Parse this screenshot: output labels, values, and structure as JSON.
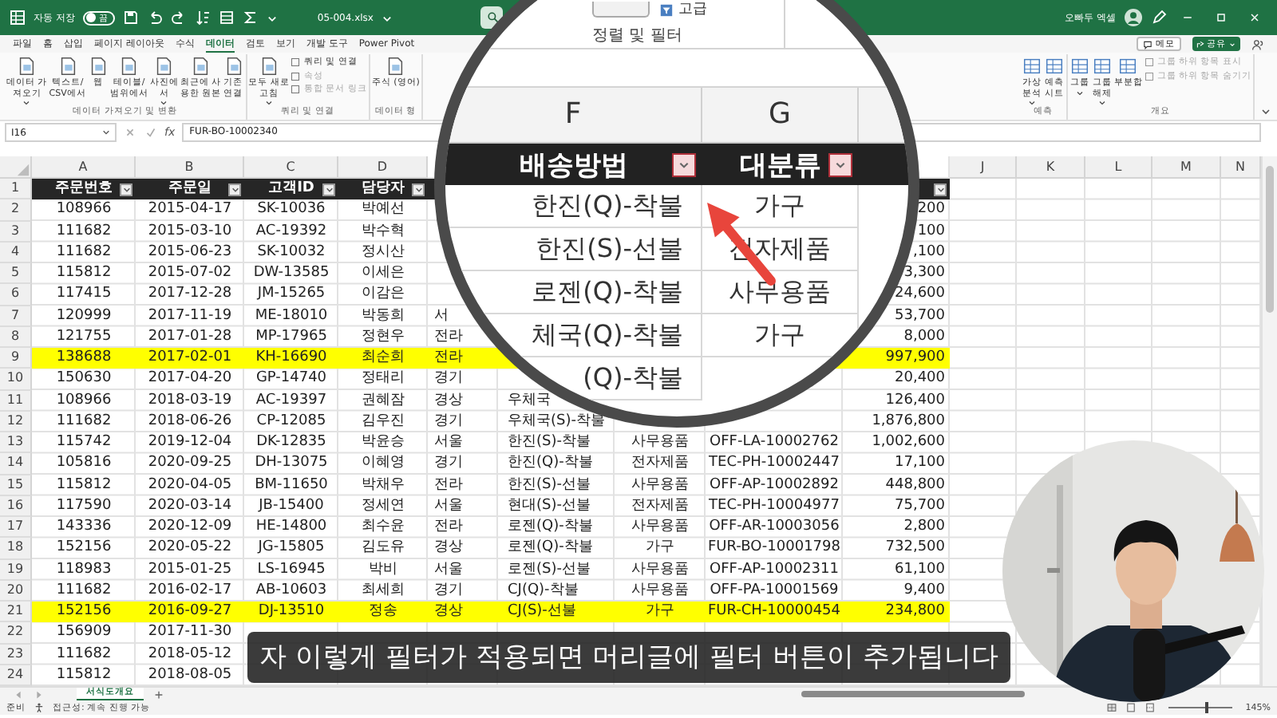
{
  "title_bar": {
    "autosave": {
      "label": "자동 저장",
      "on": false,
      "state": "끔"
    },
    "file_name": "05-004.xlsx",
    "account": "오빠두 엑셀"
  },
  "ribbon_tabs": [
    {
      "label": "파일",
      "selected": false
    },
    {
      "label": "홈",
      "selected": false
    },
    {
      "label": "삽입",
      "selected": false
    },
    {
      "label": "페이지 레이아웃",
      "selected": false
    },
    {
      "label": "수식",
      "selected": false
    },
    {
      "label": "데이터",
      "selected": true
    },
    {
      "label": "검토",
      "selected": false
    },
    {
      "label": "보기",
      "selected": false
    },
    {
      "label": "개발 도구",
      "selected": false
    },
    {
      "label": "Power Pivot",
      "selected": false
    }
  ],
  "comment_button": "메모",
  "share_button": "공유",
  "ribbon_groups": [
    {
      "name": "데이터 가져오기 및 변환",
      "buttons": [
        {
          "lines": [
            "데이터 가",
            "져오기"
          ],
          "dropdown": true
        },
        {
          "lines": [
            "텍스트/",
            "CSV에서"
          ],
          "dropdown": false
        },
        {
          "lines": [
            "웹"
          ],
          "dropdown": false
        },
        {
          "lines": [
            "테이블/",
            "범위에서"
          ],
          "dropdown": false
        },
        {
          "lines": [
            "사진에",
            "서"
          ],
          "dropdown": true
        },
        {
          "lines": [
            "최근에 사",
            "용한 원본"
          ],
          "dropdown": false
        },
        {
          "lines": [
            "기존",
            "연결"
          ],
          "dropdown": false
        }
      ]
    },
    {
      "name": "쿼리 및 연결",
      "buttons": [
        {
          "lines": [
            "모두 새로",
            "고침"
          ],
          "dropdown": true
        }
      ],
      "small_buttons": [
        {
          "label": "쿼리 및 연결",
          "disabled": false
        },
        {
          "label": "속성",
          "disabled": true
        },
        {
          "label": "통합 문서 링크",
          "disabled": true
        }
      ]
    },
    {
      "name": "데이터 형",
      "buttons": [
        {
          "lines": [
            "주식 (영어)"
          ],
          "dropdown": false
        }
      ]
    }
  ],
  "ribbon_groups_right": [
    {
      "name": "예측",
      "buttons": [
        {
          "lines": [
            "가상",
            "분석"
          ],
          "dropdown": true
        },
        {
          "lines": [
            "예측",
            "시트"
          ],
          "dropdown": false
        }
      ]
    },
    {
      "name": "개요",
      "buttons": [
        {
          "lines": [
            "그룹"
          ],
          "dropdown": true
        },
        {
          "lines": [
            "그룹",
            "해제"
          ],
          "dropdown": true
        },
        {
          "lines": [
            "부분합"
          ],
          "dropdown": false
        }
      ],
      "small_buttons": [
        {
          "label": "그룹 하위 항목 표시",
          "disabled": true
        },
        {
          "label": "그룹 하위 항목 숨기기",
          "disabled": true
        }
      ]
    }
  ],
  "formula_bar": {
    "name_box": "I16",
    "function_label": "fx",
    "formula": "FUR-BO-10002340"
  },
  "column_headers": [
    "A",
    "B",
    "C",
    "D",
    "J",
    "K",
    "L",
    "M",
    "N"
  ],
  "header_row": {
    "number": "1",
    "cells": {
      "A": {
        "text": "주문번호",
        "filter": true
      },
      "B": {
        "text": "주문일",
        "filter": true
      },
      "C": {
        "text": "고객ID",
        "filter": true
      },
      "D": {
        "text": "담당자",
        "filter": true
      },
      "I": {
        "filter": true
      }
    }
  },
  "rows": [
    {
      "number": "2",
      "highlighted": false,
      "cells": {
        "A": "108966",
        "B": "2015-04-17",
        "C": "SK-10036",
        "D": "박예선",
        "I": "200"
      }
    },
    {
      "number": "3",
      "highlighted": false,
      "cells": {
        "A": "111682",
        "B": "2015-03-10",
        "C": "AC-19392",
        "D": "박수혁",
        "I": "100"
      }
    },
    {
      "number": "4",
      "highlighted": false,
      "cells": {
        "A": "111682",
        "B": "2015-06-23",
        "C": "SK-10032",
        "D": "정시산",
        "I": ",100"
      }
    },
    {
      "number": "5",
      "highlighted": false,
      "cells": {
        "A": "115812",
        "B": "2015-07-02",
        "C": "DW-13585",
        "D": "이세은",
        "I": "3,300"
      }
    },
    {
      "number": "6",
      "highlighted": false,
      "cells": {
        "A": "117415",
        "B": "2017-12-28",
        "C": "JM-15265",
        "D": "이감은",
        "I": "24,600"
      }
    },
    {
      "number": "7",
      "highlighted": false,
      "cells": {
        "A": "120999",
        "B": "2017-11-19",
        "C": "ME-18010",
        "D": "박동희",
        "E": "서",
        "I": "53,700"
      }
    },
    {
      "number": "8",
      "highlighted": false,
      "cells": {
        "A": "121755",
        "B": "2017-01-28",
        "C": "MP-17965",
        "D": "정현우",
        "E": "전라",
        "I": "8,000"
      }
    },
    {
      "number": "9",
      "highlighted": true,
      "cells": {
        "A": "138688",
        "B": "2017-02-01",
        "C": "KH-16690",
        "D": "최순희",
        "E": "전라",
        "I": "997,900"
      }
    },
    {
      "number": "10",
      "highlighted": false,
      "cells": {
        "A": "150630",
        "B": "2017-04-20",
        "C": "GP-14740",
        "D": "정태리",
        "E": "경기",
        "I": "20,400"
      }
    },
    {
      "number": "11",
      "highlighted": false,
      "cells": {
        "A": "108966",
        "B": "2018-03-19",
        "C": "AC-19397",
        "D": "권혜잠",
        "E": "경상",
        "F": "우체국",
        "I": "126,400"
      }
    },
    {
      "number": "12",
      "highlighted": false,
      "cells": {
        "A": "111682",
        "B": "2018-06-26",
        "C": "CP-12085",
        "D": "김우진",
        "E": "경기",
        "F": "우체국(S)-착불",
        "I": "1,876,800"
      }
    },
    {
      "number": "13",
      "highlighted": false,
      "cells": {
        "A": "115742",
        "B": "2019-12-04",
        "C": "DK-12835",
        "D": "박윤승",
        "E": "서울",
        "F": "한진(S)-착불",
        "G": "사무용품",
        "H": "OFF-LA-10002762",
        "I": "1,002,600"
      }
    },
    {
      "number": "14",
      "highlighted": false,
      "cells": {
        "A": "105816",
        "B": "2020-09-25",
        "C": "DH-13075",
        "D": "이혜영",
        "E": "경기",
        "F": "한진(Q)-착불",
        "G": "전자제품",
        "H": "TEC-PH-10002447",
        "I": "17,100"
      }
    },
    {
      "number": "15",
      "highlighted": false,
      "cells": {
        "A": "115812",
        "B": "2020-04-05",
        "C": "BM-11650",
        "D": "박채우",
        "E": "전라",
        "F": "한진(S)-선불",
        "G": "사무용품",
        "H": "OFF-AP-10002892",
        "I": "448,800"
      }
    },
    {
      "number": "16",
      "highlighted": false,
      "cells": {
        "A": "117590",
        "B": "2020-03-14",
        "C": "JB-15400",
        "D": "정세연",
        "E": "서울",
        "F": "현대(S)-선불",
        "G": "전자제품",
        "H": "TEC-PH-10004977",
        "I": "75,700"
      }
    },
    {
      "number": "17",
      "highlighted": false,
      "cells": {
        "A": "143336",
        "B": "2020-12-09",
        "C": "HE-14800",
        "D": "최수윤",
        "E": "전라",
        "F": "로젠(Q)-착불",
        "G": "사무용품",
        "H": "OFF-AR-10003056",
        "I": "2,800"
      }
    },
    {
      "number": "18",
      "highlighted": false,
      "cells": {
        "A": "152156",
        "B": "2020-05-22",
        "C": "JG-15805",
        "D": "김도유",
        "E": "경상",
        "F": "로젠(Q)-착불",
        "G": "가구",
        "H": "FUR-BO-10001798",
        "I": "732,500"
      }
    },
    {
      "number": "19",
      "highlighted": false,
      "cells": {
        "A": "118983",
        "B": "2015-01-25",
        "C": "LS-16945",
        "D": "박비",
        "E": "서울",
        "F": "로젠(S)-선불",
        "G": "사무용품",
        "H": "OFF-AP-10002311",
        "I": "61,100"
      }
    },
    {
      "number": "20",
      "highlighted": false,
      "cells": {
        "A": "111682",
        "B": "2016-02-17",
        "C": "AB-10603",
        "D": "최세희",
        "E": "경기",
        "F": "CJ(Q)-착불",
        "G": "사무용품",
        "H": "OFF-PA-10001569",
        "I": "9,400"
      }
    },
    {
      "number": "21",
      "highlighted": true,
      "cells": {
        "A": "152156",
        "B": "2016-09-27",
        "C": "DJ-13510",
        "D": "정송",
        "E": "경상",
        "F": "CJ(S)-선불",
        "G": "가구",
        "H": "FUR-CH-10000454",
        "I": "234,800"
      }
    },
    {
      "number": "22",
      "highlighted": false,
      "cells": {
        "A": "156909",
        "B": "2017-11-30"
      }
    },
    {
      "number": "23",
      "highlighted": false,
      "cells": {
        "A": "111682",
        "B": "2018-05-12"
      }
    },
    {
      "number": "24",
      "highlighted": false,
      "cells": {
        "A": "115812",
        "B": "2018-08-05"
      }
    }
  ],
  "magnifier": {
    "ribbon": {
      "button_label": "고급",
      "group_label": "정렬 및 필터"
    },
    "column_headers": [
      "F",
      "G"
    ],
    "header_cells": [
      {
        "text": "배송방법",
        "filter": true
      },
      {
        "text": "대분류",
        "filter": true
      }
    ],
    "rows": [
      {
        "F": "한진(Q)-착불",
        "G": "가구"
      },
      {
        "F": "한진(S)-선불",
        "G": "전자제품"
      },
      {
        "F": "로젠(Q)-착불",
        "G": "사무용품"
      },
      {
        "F": "체국(Q)-착불",
        "G": "가구"
      },
      {
        "F": "(Q)-착불"
      }
    ]
  },
  "subtitle": "자 이렇게 필터가 적용되면 머리글에 필터 버튼이 추가됩니다",
  "presenter_video": {
    "kind": "picture"
  },
  "sheet_tabs": [
    {
      "label": "서식도개요",
      "selected": true
    }
  ],
  "status_bar": {
    "mode": "준비",
    "accessibility": "접근성: 계속 진행 가능",
    "zoom": {
      "level": 0.6,
      "reading": "145%"
    }
  }
}
